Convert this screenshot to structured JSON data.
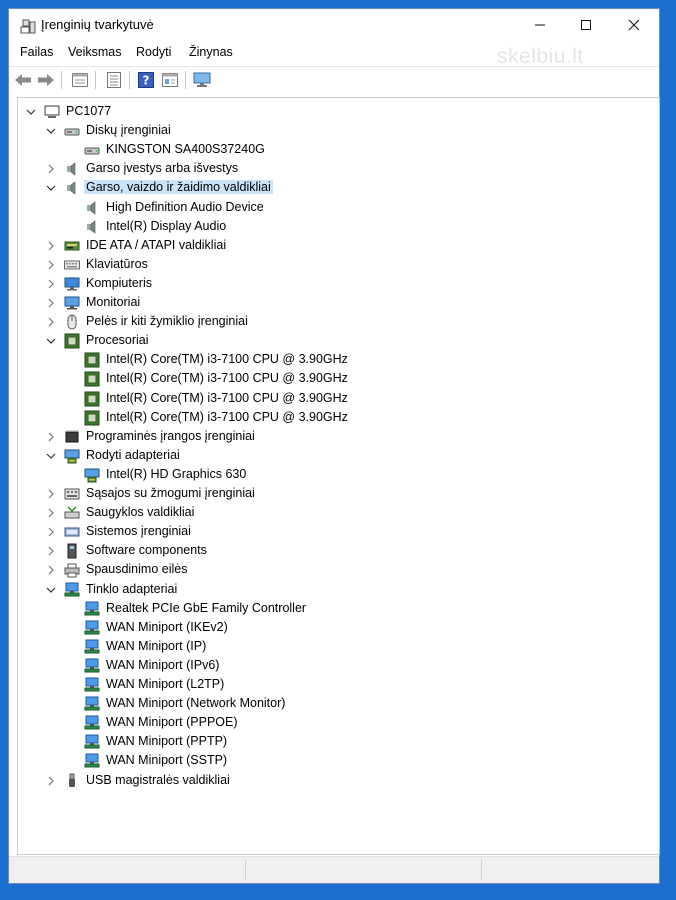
{
  "window": {
    "title": "Įrenginių tvarkytuvė"
  },
  "menu": [
    "Failas",
    "Veiksmas",
    "Rodyti",
    "Žinynas"
  ],
  "watermark": "skelbiu.lt",
  "toolbar": [
    "back-icon",
    "forward-icon",
    "properties-window-icon",
    "list-view-icon",
    "help-icon",
    "details-view-icon",
    "monitor-icon"
  ],
  "tree": [
    {
      "level": 0,
      "expander": "expanded",
      "icon": "computer-icon",
      "label": "PC1077"
    },
    {
      "level": 1,
      "expander": "expanded",
      "icon": "disk-drive-icon",
      "label": "Diskų įrenginiai"
    },
    {
      "level": 2,
      "expander": "none",
      "icon": "disk-drive-icon",
      "label": "KINGSTON SA400S37240G"
    },
    {
      "level": 1,
      "expander": "collapsed",
      "icon": "speaker-icon",
      "label": "Garso įvestys arba išvestys"
    },
    {
      "level": 1,
      "expander": "expanded",
      "icon": "speaker-icon",
      "label": "Garso, vaizdo ir žaidimo valdikliai",
      "selected": true
    },
    {
      "level": 2,
      "expander": "none",
      "icon": "speaker-icon",
      "label": "High Definition Audio Device"
    },
    {
      "level": 2,
      "expander": "none",
      "icon": "speaker-icon",
      "label": "Intel(R) Display Audio"
    },
    {
      "level": 1,
      "expander": "collapsed",
      "icon": "ide-controller-icon",
      "label": "IDE ATA / ATAPI valdikliai"
    },
    {
      "level": 1,
      "expander": "collapsed",
      "icon": "keyboard-icon",
      "label": "Klaviatūros"
    },
    {
      "level": 1,
      "expander": "collapsed",
      "icon": "computer-monitor-icon",
      "label": "Kompiuteris"
    },
    {
      "level": 1,
      "expander": "collapsed",
      "icon": "monitor-icon",
      "label": "Monitoriai"
    },
    {
      "level": 1,
      "expander": "collapsed",
      "icon": "mouse-icon",
      "label": "Pelės ir kiti žymiklio įrenginiai"
    },
    {
      "level": 1,
      "expander": "expanded",
      "icon": "processor-icon",
      "label": "Procesoriai"
    },
    {
      "level": 2,
      "expander": "none",
      "icon": "processor-icon",
      "label": "Intel(R) Core(TM) i3-7100 CPU @ 3.90GHz"
    },
    {
      "level": 2,
      "expander": "none",
      "icon": "processor-icon",
      "label": "Intel(R) Core(TM) i3-7100 CPU @ 3.90GHz"
    },
    {
      "level": 2,
      "expander": "none",
      "icon": "processor-icon",
      "label": "Intel(R) Core(TM) i3-7100 CPU @ 3.90GHz"
    },
    {
      "level": 2,
      "expander": "none",
      "icon": "processor-icon",
      "label": "Intel(R) Core(TM) i3-7100 CPU @ 3.90GHz"
    },
    {
      "level": 1,
      "expander": "collapsed",
      "icon": "firmware-icon",
      "label": "Programinės įrangos įrenginiai"
    },
    {
      "level": 1,
      "expander": "expanded",
      "icon": "display-adapter-icon",
      "label": "Rodyti adapteriai"
    },
    {
      "level": 2,
      "expander": "none",
      "icon": "display-adapter-icon",
      "label": "Intel(R) HD Graphics 630"
    },
    {
      "level": 1,
      "expander": "collapsed",
      "icon": "hid-icon",
      "label": "Sąsajos su žmogumi įrenginiai"
    },
    {
      "level": 1,
      "expander": "collapsed",
      "icon": "storage-controller-icon",
      "label": "Saugyklos valdikliai"
    },
    {
      "level": 1,
      "expander": "collapsed",
      "icon": "system-device-icon",
      "label": "Sistemos įrenginiai"
    },
    {
      "level": 1,
      "expander": "collapsed",
      "icon": "software-component-icon",
      "label": "Software components"
    },
    {
      "level": 1,
      "expander": "collapsed",
      "icon": "print-queue-icon",
      "label": "Spausdinimo eilės"
    },
    {
      "level": 1,
      "expander": "expanded",
      "icon": "network-adapter-icon",
      "label": "Tinklo adapteriai"
    },
    {
      "level": 2,
      "expander": "none",
      "icon": "network-adapter-icon",
      "label": "Realtek PCIe GbE Family Controller"
    },
    {
      "level": 2,
      "expander": "none",
      "icon": "network-adapter-icon",
      "label": "WAN Miniport (IKEv2)"
    },
    {
      "level": 2,
      "expander": "none",
      "icon": "network-adapter-icon",
      "label": "WAN Miniport (IP)"
    },
    {
      "level": 2,
      "expander": "none",
      "icon": "network-adapter-icon",
      "label": "WAN Miniport (IPv6)"
    },
    {
      "level": 2,
      "expander": "none",
      "icon": "network-adapter-icon",
      "label": "WAN Miniport (L2TP)"
    },
    {
      "level": 2,
      "expander": "none",
      "icon": "network-adapter-icon",
      "label": "WAN Miniport (Network Monitor)"
    },
    {
      "level": 2,
      "expander": "none",
      "icon": "network-adapter-icon",
      "label": "WAN Miniport (PPPOE)"
    },
    {
      "level": 2,
      "expander": "none",
      "icon": "network-adapter-icon",
      "label": "WAN Miniport (PPTP)"
    },
    {
      "level": 2,
      "expander": "none",
      "icon": "network-adapter-icon",
      "label": "WAN Miniport (SSTP)"
    },
    {
      "level": 1,
      "expander": "collapsed",
      "icon": "usb-icon",
      "label": "USB magistralės valdikliai"
    }
  ]
}
